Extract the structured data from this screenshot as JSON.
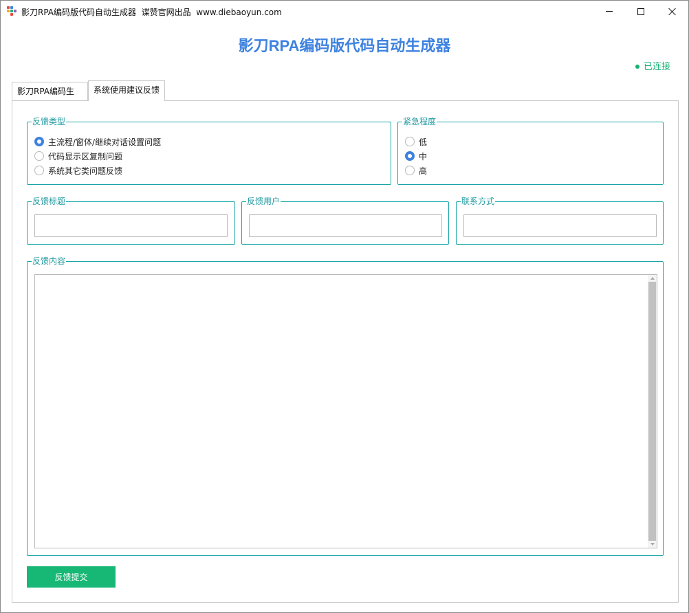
{
  "window": {
    "title": "影刀RPA编码版代码自动生成器  谍赞官网出品  www.diebaoyun.com",
    "controls": [
      "minimize",
      "maximize",
      "close"
    ]
  },
  "header": {
    "app_title": "影刀RPA编码版代码自动生成器",
    "status": "已连接",
    "status_color": "#17b075",
    "title_color": "#3e82e0"
  },
  "tabs": [
    {
      "label": "影刀RPA编码生成",
      "active": false
    },
    {
      "label": "系统使用建议反馈",
      "active": true
    }
  ],
  "form": {
    "feedback_type": {
      "label": "反馈类型",
      "options": [
        {
          "label": "主流程/窗体/继续对话设置问题",
          "checked": true
        },
        {
          "label": "代码显示区复制问题",
          "checked": false
        },
        {
          "label": "系统其它类问题反馈",
          "checked": false
        }
      ]
    },
    "urgency": {
      "label": "紧急程度",
      "options": [
        {
          "label": "低",
          "checked": false
        },
        {
          "label": "中",
          "checked": true
        },
        {
          "label": "高",
          "checked": false
        }
      ]
    },
    "title_field": {
      "label": "反馈标题",
      "value": ""
    },
    "user_field": {
      "label": "反馈用户",
      "value": ""
    },
    "contact_field": {
      "label": "联系方式",
      "value": ""
    },
    "content_field": {
      "label": "反馈内容",
      "value": ""
    },
    "submit_label": "反馈提交",
    "accent_color": "#1aa5a8",
    "button_color": "#17b875"
  }
}
